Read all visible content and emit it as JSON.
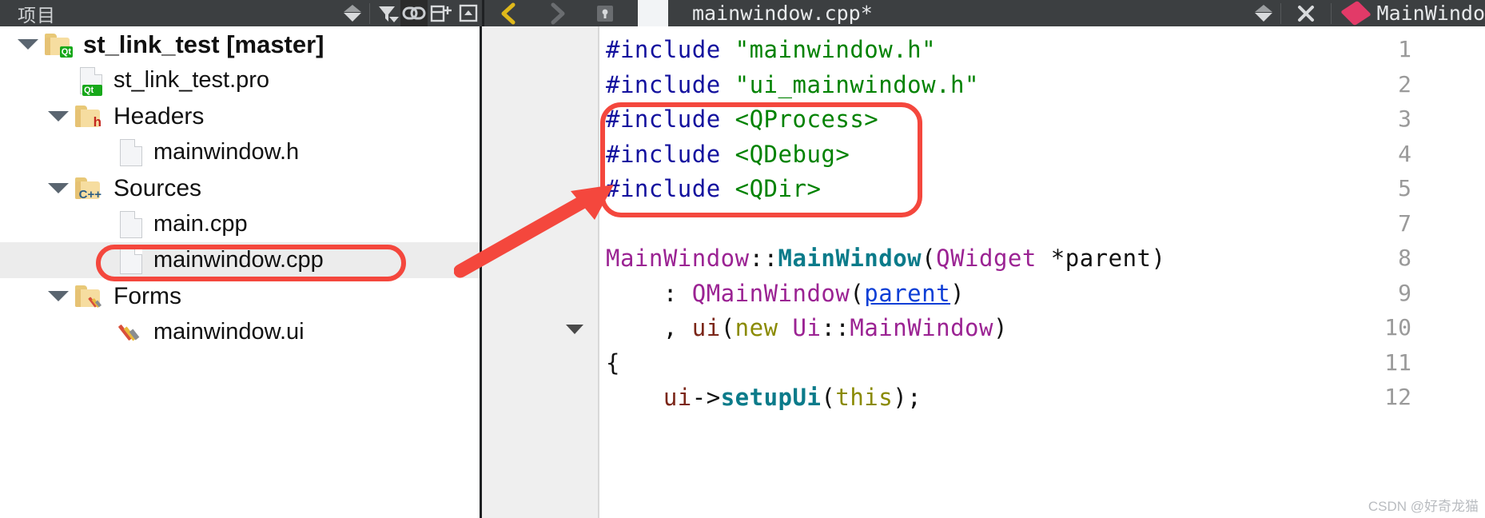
{
  "topbar": {
    "panel_title": "项目",
    "icons": {
      "sync_dropdown": "chevron-down-icon",
      "filter": "filter-icon",
      "link": "link-icon",
      "add_split": "split-add-icon",
      "collapse": "collapse-icon",
      "nav_back": "back-chevron-icon",
      "nav_forward": "forward-chevron-icon",
      "lock": "lock-icon",
      "doc_chip": "document-chip-icon",
      "tab_dropdown": "chevron-down-icon",
      "close": "close-icon",
      "symbol_marker": "class-diamond-icon"
    },
    "active_file": "mainwindow.cpp*",
    "symbol_name": "MainWindo"
  },
  "sidebar": {
    "items": [
      {
        "label": "st_link_test [master]",
        "icon": "folder-qt-icon",
        "indent": 22,
        "expander": true,
        "bold": true,
        "font_size": 31,
        "selected": false
      },
      {
        "label": "st_link_test.pro",
        "icon": "document-qt-icon",
        "indent": 100,
        "expander": false,
        "bold": false,
        "font_size": 29,
        "selected": false
      },
      {
        "label": "Headers",
        "icon": "folder-h-icon",
        "indent": 60,
        "expander": true,
        "bold": false,
        "font_size": 30,
        "selected": false
      },
      {
        "label": "mainwindow.h",
        "icon": "document-icon",
        "indent": 150,
        "expander": false,
        "bold": false,
        "font_size": 29,
        "selected": false
      },
      {
        "label": "Sources",
        "icon": "folder-cpp-icon",
        "indent": 60,
        "expander": true,
        "bold": false,
        "font_size": 30,
        "selected": false
      },
      {
        "label": "main.cpp",
        "icon": "document-icon",
        "indent": 150,
        "expander": false,
        "bold": false,
        "font_size": 29,
        "selected": false
      },
      {
        "label": "mainwindow.cpp",
        "icon": "document-icon",
        "indent": 150,
        "expander": false,
        "bold": false,
        "font_size": 29,
        "selected": true
      },
      {
        "label": "Forms",
        "icon": "folder-ui-icon",
        "indent": 60,
        "expander": true,
        "bold": false,
        "font_size": 30,
        "selected": false
      },
      {
        "label": "mainwindow.ui",
        "icon": "pencil-icon",
        "indent": 150,
        "expander": false,
        "bold": false,
        "font_size": 29,
        "selected": false
      }
    ]
  },
  "editor": {
    "lines": [
      {
        "num": "1",
        "fold": false,
        "tokens": [
          {
            "t": "#include ",
            "c": "k-pre"
          },
          {
            "t": "\"mainwindow.h\"",
            "c": "k-str"
          }
        ]
      },
      {
        "num": "2",
        "fold": false,
        "tokens": [
          {
            "t": "#include ",
            "c": "k-pre"
          },
          {
            "t": "\"ui_mainwindow.h\"",
            "c": "k-str"
          }
        ]
      },
      {
        "num": "3",
        "fold": false,
        "tokens": [
          {
            "t": "#include ",
            "c": "k-pre"
          },
          {
            "t": "<QProcess>",
            "c": "k-str"
          }
        ]
      },
      {
        "num": "4",
        "fold": false,
        "tokens": [
          {
            "t": "#include ",
            "c": "k-pre"
          },
          {
            "t": "<QDebug>",
            "c": "k-str"
          }
        ]
      },
      {
        "num": "5",
        "fold": false,
        "tokens": [
          {
            "t": "#include ",
            "c": "k-pre"
          },
          {
            "t": "<QDir>",
            "c": "k-str"
          }
        ]
      },
      {
        "num": "7",
        "fold": false,
        "tokens": []
      },
      {
        "num": "8",
        "fold": false,
        "tokens": [
          {
            "t": "MainWindow",
            "c": "k-cls"
          },
          {
            "t": "::",
            "c": "k-plain"
          },
          {
            "t": "MainWindow",
            "c": "k-fn"
          },
          {
            "t": "(",
            "c": "k-plain"
          },
          {
            "t": "QWidget",
            "c": "k-cls"
          },
          {
            "t": " *parent)",
            "c": "k-plain"
          }
        ]
      },
      {
        "num": "9",
        "fold": false,
        "tokens": [
          {
            "t": "    : ",
            "c": "k-plain"
          },
          {
            "t": "QMainWindow",
            "c": "k-cls"
          },
          {
            "t": "(",
            "c": "k-plain"
          },
          {
            "t": "parent",
            "c": "k-link"
          },
          {
            "t": ")",
            "c": "k-plain"
          }
        ]
      },
      {
        "num": "10",
        "fold": true,
        "tokens": [
          {
            "t": "    , ",
            "c": "k-plain"
          },
          {
            "t": "ui",
            "c": "k-var"
          },
          {
            "t": "(",
            "c": "k-plain"
          },
          {
            "t": "new",
            "c": "k-kw"
          },
          {
            "t": " ",
            "c": "k-plain"
          },
          {
            "t": "Ui",
            "c": "k-cls"
          },
          {
            "t": "::",
            "c": "k-plain"
          },
          {
            "t": "MainWindow",
            "c": "k-cls"
          },
          {
            "t": ")",
            "c": "k-plain"
          }
        ]
      },
      {
        "num": "11",
        "fold": false,
        "tokens": [
          {
            "t": "{",
            "c": "k-plain"
          }
        ]
      },
      {
        "num": "12",
        "fold": false,
        "tokens": [
          {
            "t": "    ",
            "c": "k-plain"
          },
          {
            "t": "ui",
            "c": "k-var"
          },
          {
            "t": "->",
            "c": "k-plain"
          },
          {
            "t": "setupUi",
            "c": "k-fn"
          },
          {
            "t": "(",
            "c": "k-plain"
          },
          {
            "t": "this",
            "c": "k-this"
          },
          {
            "t": ");",
            "c": "k-plain"
          }
        ]
      }
    ]
  },
  "annotations": {
    "box_includes": "red-highlight-box",
    "box_file": "red-highlight-box",
    "arrow": "red-arrow-annotation",
    "accent_red": "#f4473d"
  },
  "watermark": "CSDN @好奇龙猫"
}
